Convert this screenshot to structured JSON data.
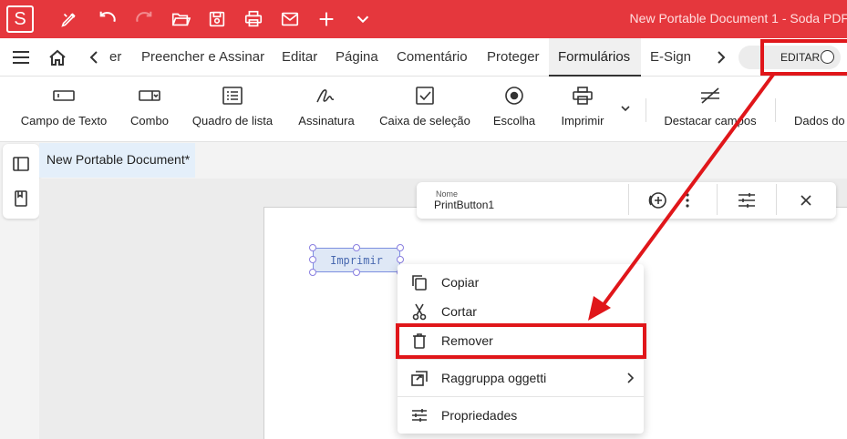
{
  "titlebar": {
    "logo_letter": "S",
    "doc_title": "New Portable Document 1   -   Soda PDF",
    "icons": [
      "pen-icon",
      "undo-icon",
      "redo-icon",
      "folder-open-icon",
      "save-icon",
      "print-icon",
      "mail-icon",
      "plus-icon",
      "chevron-down-icon"
    ]
  },
  "menubar": {
    "items": [
      "er",
      "Preencher e Assinar",
      "Editar",
      "Página",
      "Comentário",
      "Proteger",
      "Formulários",
      "E-Sign"
    ],
    "active": "Formulários",
    "edit_toggle": "EDITAR"
  },
  "ribbon": {
    "items": [
      "Campo de Texto",
      "Combo",
      "Quadro de lista",
      "Assinatura",
      "Caixa de seleção",
      "Escolha",
      "Imprimir",
      "Destacar campos",
      "Dados do"
    ]
  },
  "doc_tab": "New Portable Document*",
  "props_bar": {
    "name_label": "Nome",
    "name_value": "PrintButton1"
  },
  "field": {
    "label": "Imprimir"
  },
  "context_menu": {
    "items": [
      "Copiar",
      "Cortar",
      "Remover",
      "Raggruppa oggetti",
      "Propriedades"
    ]
  },
  "colors": {
    "brand": "#e5373d",
    "highlight": "#e0161a"
  }
}
